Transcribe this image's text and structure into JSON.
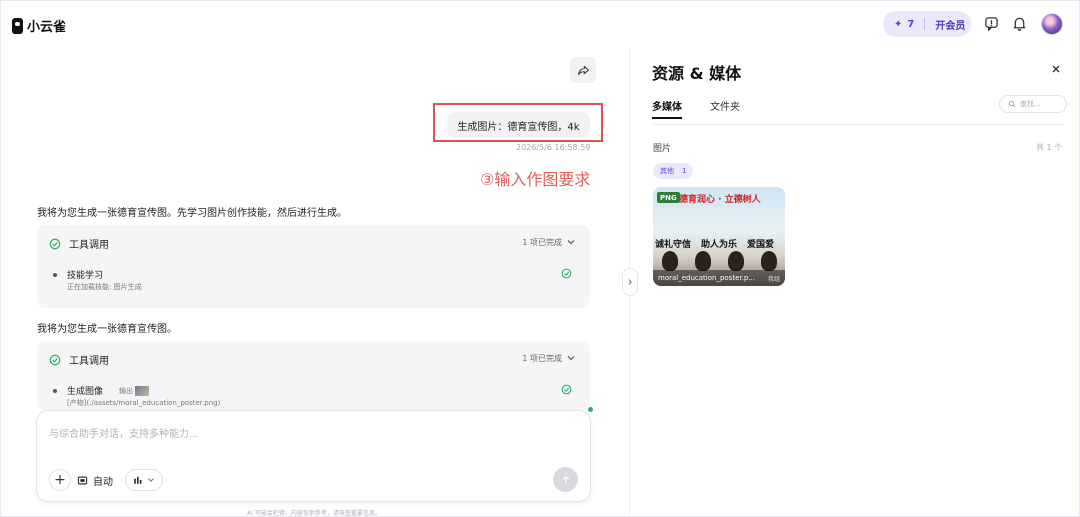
{
  "app": {
    "name": "小云雀"
  },
  "header": {
    "credits": "7",
    "vip_label": "开会员",
    "credit_icon": "spark-icon"
  },
  "chat": {
    "user_message": "生成图片：德育宣传图，4k",
    "user_message_time": "2026/5/6 16:58:59",
    "annotation": "③输入作图要求",
    "assistant_1": "我将为您生成一张德育宣传图。先学习图片创作技能，然后进行生成。",
    "tool_card_1": {
      "title": "工具调用",
      "status": "1 项已完成",
      "step": "技能学习",
      "step_sub": "正在加载技能: 图片生成"
    },
    "assistant_2": "我将为您生成一张德育宣传图。",
    "tool_card_2": {
      "title": "工具调用",
      "status": "1 项已完成",
      "step": "生成图像",
      "output_label": "输出",
      "step_sub": "[产物](./assets/moral_education_poster.png)"
    }
  },
  "composer": {
    "placeholder": "与综合助手对话，支持多种能力...",
    "mode_label": "自动",
    "footer_note": "AI 可能会犯错，内容仅供参考，请核查重要信息。"
  },
  "panel": {
    "title": "资源 & 媒体",
    "tabs": [
      "多媒体",
      "文件夹"
    ],
    "search_placeholder": "查找...",
    "section_label": "图片",
    "section_count": "共 1 个",
    "chip_label": "其他",
    "chip_count": "1",
    "media": {
      "badge": "PNG",
      "poster_title": "德育润心 · 立德树人",
      "poster_words": [
        "诚礼守信",
        "助人为乐",
        "爱国爱"
      ],
      "filename": "moral_education_poster.p...",
      "source": "我组"
    }
  },
  "colors": {
    "accent": "#5b3fd6",
    "annotation": "#e06060",
    "success": "#2bb36b"
  }
}
